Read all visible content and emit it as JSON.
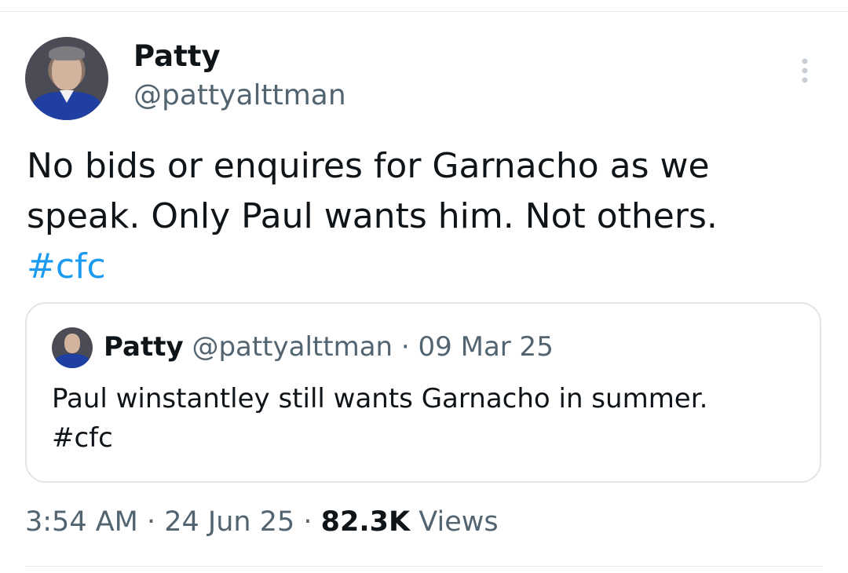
{
  "tweet": {
    "author_name": "Patty",
    "author_handle": "@pattyalttman",
    "text_line1": "No bids or enquires for Garnacho as we",
    "text_line2": "speak. Only Paul wants him. Not others.",
    "hashtag": "#cfc",
    "time": "3:54 AM",
    "date": "24 Jun 25",
    "views_count": "82.3K",
    "views_label": "Views",
    "separator": " · "
  },
  "quote": {
    "author_name": "Patty",
    "author_handle": "@pattyalttman",
    "date": "09 Mar 25",
    "separator": " · ",
    "text_line1": "Paul winstantley still wants Garnacho in summer.",
    "hashtag": "#cfc"
  },
  "colors": {
    "link": "#1d9bf0",
    "secondary_text": "#536471",
    "primary_text": "#0f1419",
    "border": "#e3e6e8"
  },
  "icons": {
    "more": "more-vertical-icon"
  }
}
